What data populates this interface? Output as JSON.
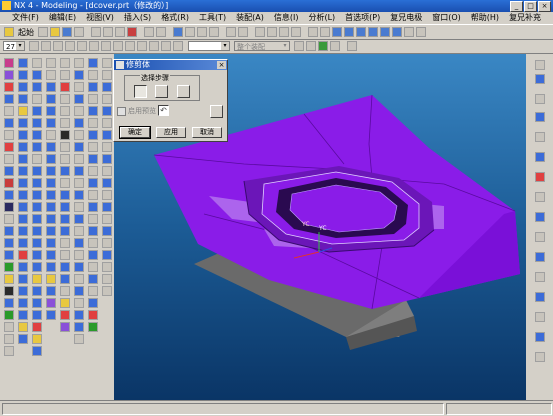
{
  "window": {
    "title": "NX 4 - Modeling - [dcover.prt（修改的）]",
    "controls": [
      "_",
      "□",
      "×"
    ]
  },
  "menu": {
    "items": [
      "文件(F)",
      "编辑(E)",
      "视图(V)",
      "插入(S)",
      "格式(R)",
      "工具(T)",
      "装配(A)",
      "信息(I)",
      "分析(L)",
      "首选项(P)",
      "复兄电极",
      "窗口(O)",
      "帮助(H)",
      "复兄补充"
    ]
  },
  "toolbar": {
    "start_label": "起始",
    "layer_value": "27",
    "filter_placeholder": "整个装配"
  },
  "dialog": {
    "title": "修剪体",
    "group_label": "选择步骤",
    "preview_label": "启用预览",
    "ok_label": "确定",
    "apply_label": "应用",
    "cancel_label": "取消"
  },
  "viewport": {
    "axis_label": "YC"
  },
  "colors": {
    "model": "#8a1ce8",
    "background_top": "#3a87c4",
    "background_bottom": "#0a3566"
  }
}
